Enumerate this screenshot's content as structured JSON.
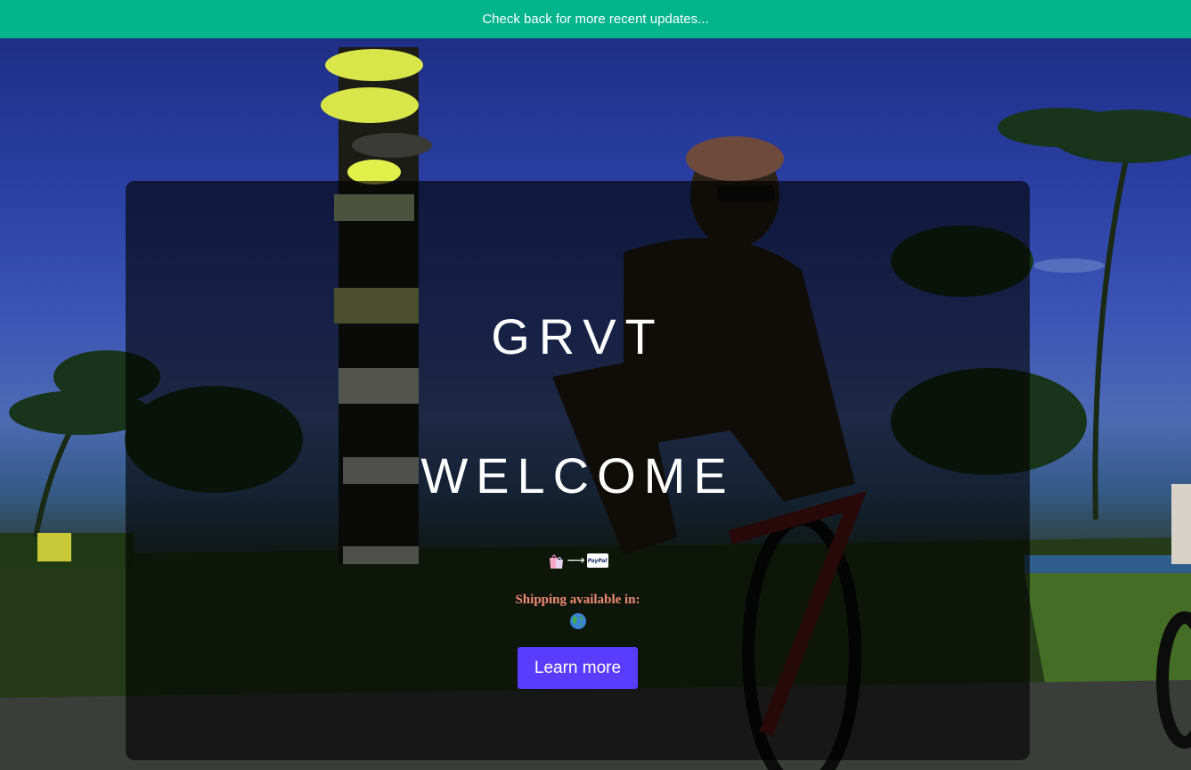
{
  "announcement": {
    "text": "Check back for more recent updates..."
  },
  "hero": {
    "brand": "GRVT",
    "headline": "WELCOME",
    "payment_icons": [
      "shopping-bags-icon",
      "right-arrow-icon",
      "paypal-icon"
    ],
    "paypal_badge_text": "PayPal",
    "arrow_glyph": "⟶",
    "shipping_label": "Shipping available in:",
    "shipping_icon": "globe-icon",
    "cta_label": "Learn more"
  },
  "colors": {
    "announcement_bg": "#00b48c",
    "cta_bg": "#5a3cff",
    "shipping_text": "#f08a78"
  }
}
